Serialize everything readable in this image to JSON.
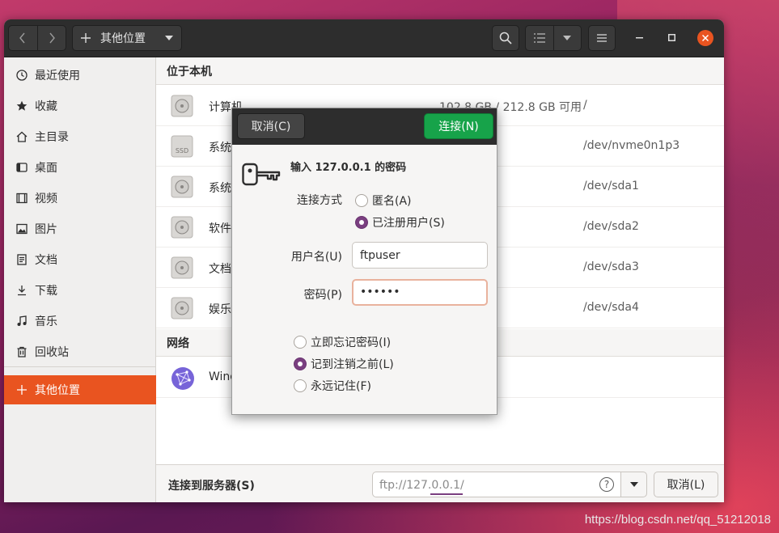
{
  "window": {
    "path_label": "其他位置"
  },
  "sidebar": {
    "items": [
      {
        "label": "最近使用",
        "icon": "clock-icon"
      },
      {
        "label": "收藏",
        "icon": "star-icon"
      },
      {
        "label": "主目录",
        "icon": "home-icon"
      },
      {
        "label": "桌面",
        "icon": "desktop-icon"
      },
      {
        "label": "视频",
        "icon": "video-icon"
      },
      {
        "label": "图片",
        "icon": "picture-icon"
      },
      {
        "label": "文档",
        "icon": "document-icon"
      },
      {
        "label": "下载",
        "icon": "download-icon"
      },
      {
        "label": "音乐",
        "icon": "music-icon"
      },
      {
        "label": "回收站",
        "icon": "trash-icon"
      },
      {
        "label": "其他位置",
        "icon": "plus-icon",
        "active": true
      }
    ]
  },
  "main": {
    "local_header": "位于本机",
    "network_header": "网络",
    "drives": [
      {
        "name": "计算机",
        "space": "102.8 GB / 212.8 GB 可用",
        "path": "/"
      },
      {
        "name": "系统",
        "space": "",
        "path": "/dev/nvme0n1p3",
        "ssd_label": "SSD"
      },
      {
        "name": "系统",
        "space": "",
        "path": "/dev/sda1"
      },
      {
        "name": "软件",
        "space": "",
        "path": "/dev/sda2"
      },
      {
        "name": "文档",
        "space": "",
        "path": "/dev/sda3"
      },
      {
        "name": "娱乐",
        "space": "",
        "path": "/dev/sda4"
      }
    ],
    "network": [
      {
        "name": "Wind"
      }
    ]
  },
  "bottombar": {
    "connect_label": "连接到服务器(S)",
    "server_value": "ftp://127.0.0.1/",
    "help_glyph": "?",
    "cancel_label": "取消(L)"
  },
  "dialog": {
    "cancel_label": "取消(C)",
    "connect_label": "连接(N)",
    "prompt": "输入 127.0.0.1 的密码",
    "connect_method_label": "连接方式",
    "method_options": [
      {
        "label": "匿名(A)",
        "checked": false
      },
      {
        "label": "已注册用户(S)",
        "checked": true
      }
    ],
    "username_label": "用户名(U)",
    "username_value": "ftpuser",
    "password_label": "密码(P)",
    "password_value": "••••••",
    "remember_options": [
      {
        "label": "立即忘记密码(I)",
        "checked": false
      },
      {
        "label": "记到注销之前(L)",
        "checked": true
      },
      {
        "label": "永远记住(F)",
        "checked": false
      }
    ]
  },
  "watermark": "https://blog.csdn.net/qq_51212018",
  "colors": {
    "accent": "#e95420",
    "connect_green": "#17a34a",
    "radio_checked": "#7a3f80"
  }
}
